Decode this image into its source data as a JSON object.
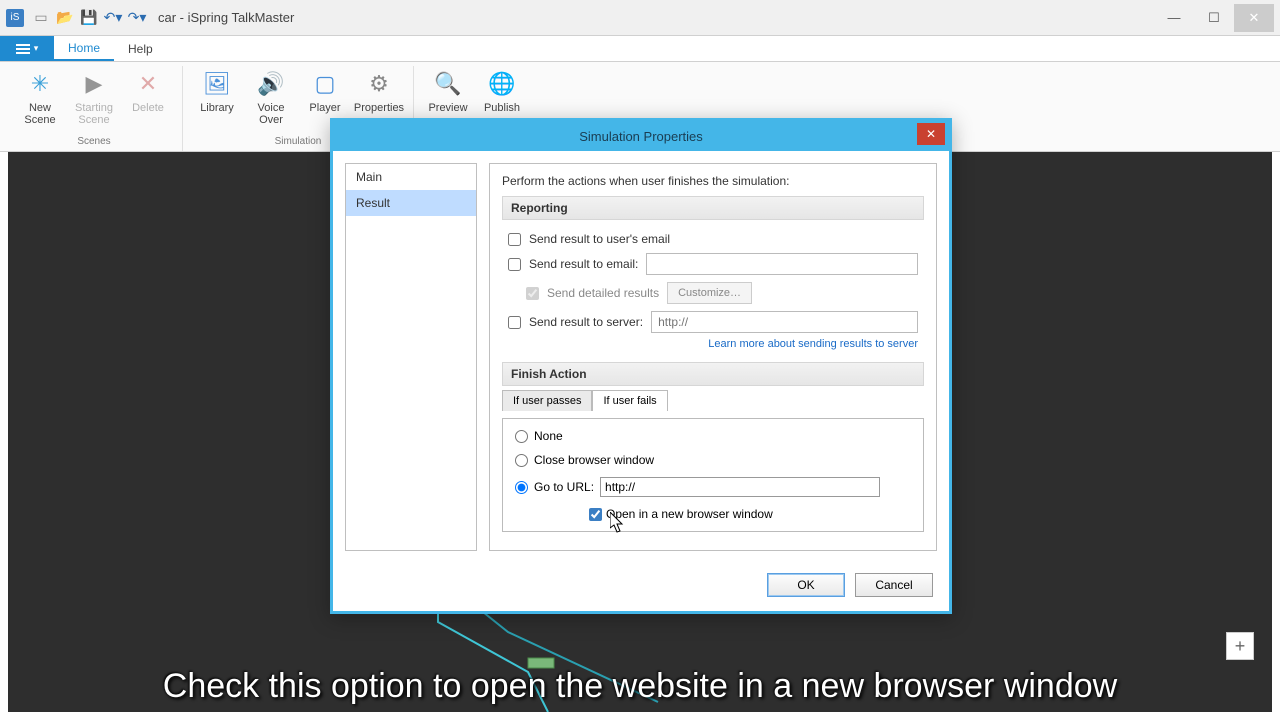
{
  "window": {
    "title": "car - iSpring TalkMaster"
  },
  "tabs": {
    "file": "",
    "home": "Home",
    "help": "Help"
  },
  "ribbon": {
    "scenes_group": "Scenes",
    "simulation_group": "Simulation",
    "new_scene": "New Scene",
    "starting_scene": "Starting Scene",
    "delete": "Delete",
    "library": "Library",
    "voice_over": "Voice Over",
    "player": "Player",
    "properties": "Properties",
    "preview": "Preview",
    "publish": "Publish"
  },
  "dialog": {
    "title": "Simulation Properties",
    "side": {
      "main": "Main",
      "result": "Result"
    },
    "intro": "Perform the actions when user finishes the simulation:",
    "reporting": {
      "header": "Reporting",
      "send_user_email": "Send result to user's email",
      "send_email": "Send result to email:",
      "detailed": "Send detailed results",
      "customize": "Customize…",
      "send_server": "Send result to server:",
      "server_placeholder": "http://",
      "learn_more": "Learn more about sending results to server"
    },
    "finish": {
      "header": "Finish Action",
      "tab_pass": "If user passes",
      "tab_fail": "If user fails",
      "none": "None",
      "close": "Close browser window",
      "goto": "Go to URL:",
      "url_value": "http://",
      "new_window": "Open in a new browser window"
    },
    "ok": "OK",
    "cancel": "Cancel"
  },
  "caption": "Check this option to open the website in a new browser window",
  "plus": "+"
}
